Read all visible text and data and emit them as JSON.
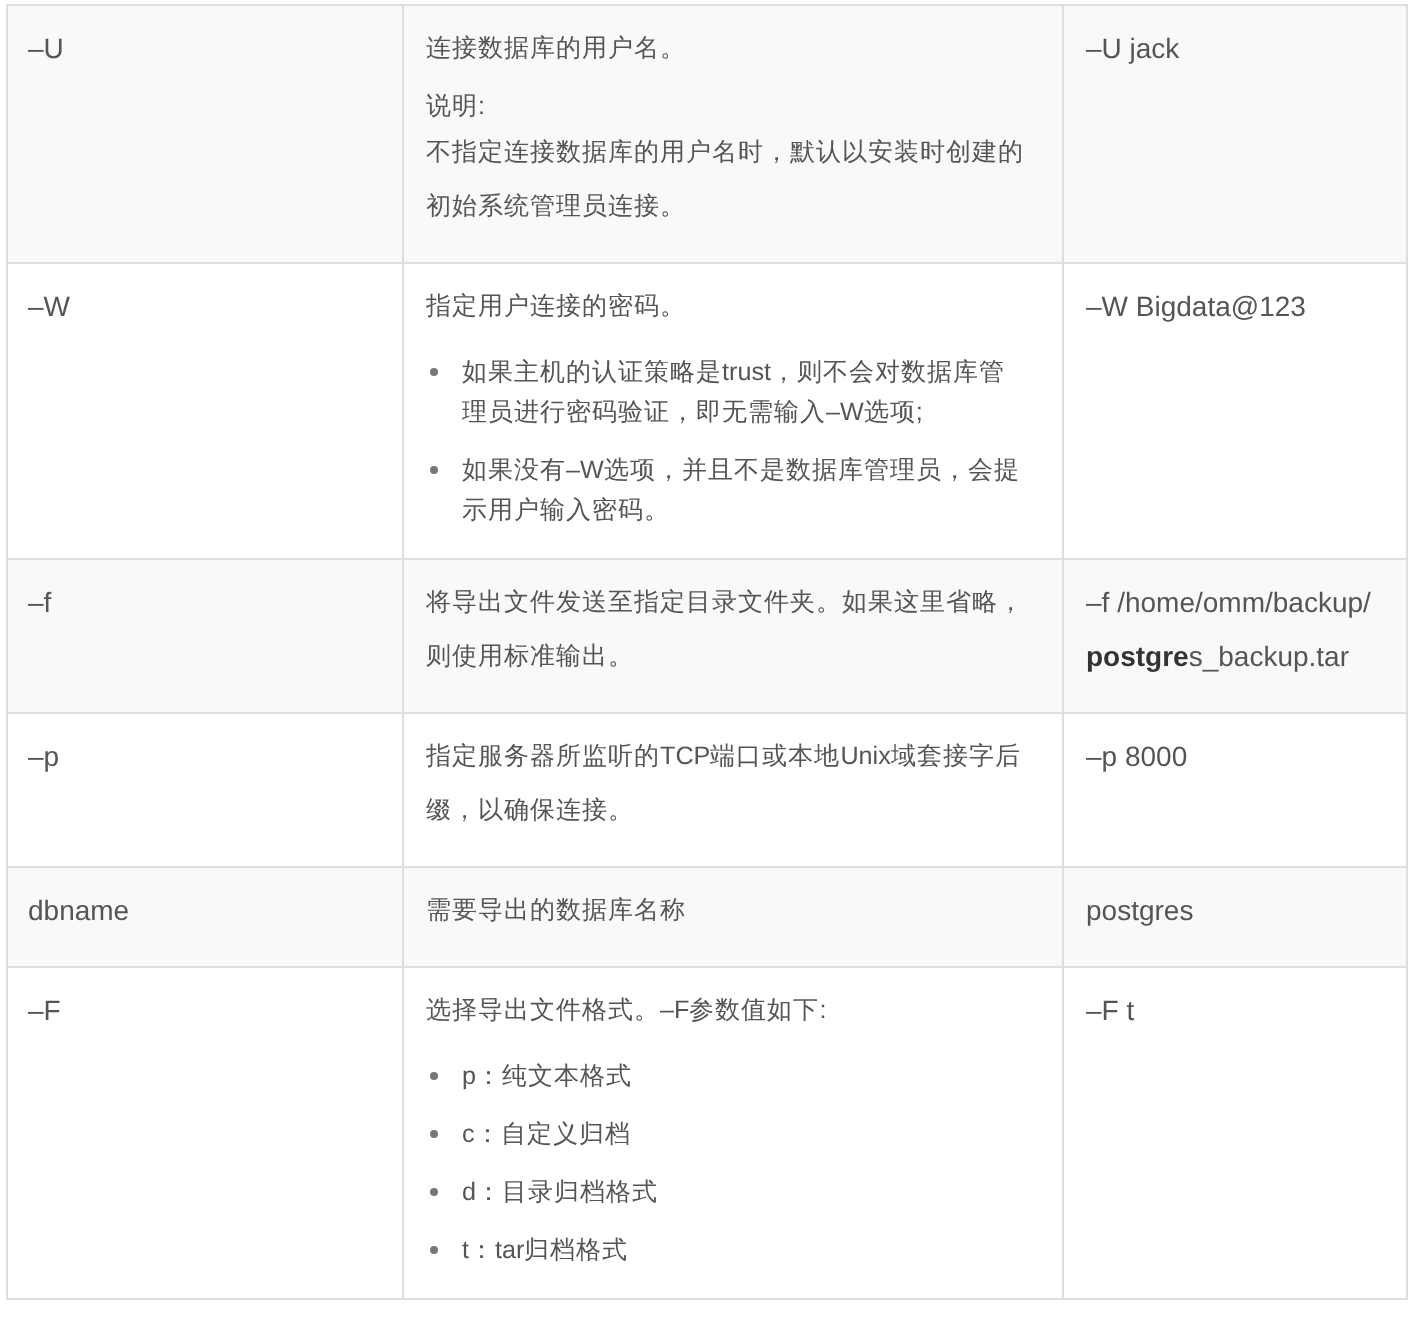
{
  "table": {
    "rows": [
      {
        "parameter": "–U",
        "description": [
          {
            "kind": "para",
            "text": "连接数据库的用户名。"
          },
          {
            "kind": "note",
            "label": "说明:",
            "text": "不指定连接数据库的用户名时，默认以安装时创建的初始系统管理员连接。"
          }
        ],
        "example": "–U jack"
      },
      {
        "parameter": "–W",
        "description": [
          {
            "kind": "para",
            "text": "指定用户连接的密码。"
          },
          {
            "kind": "bullets",
            "items": [
              "如果主机的认证策略是trust，则不会对数据库管理员进行密码验证，即无需输入–W选项;",
              "如果没有–W选项，并且不是数据库管理员，会提示用户输入密码。"
            ]
          }
        ],
        "example": "–W Bigdata@123"
      },
      {
        "parameter": "–f",
        "description": [
          {
            "kind": "para",
            "text": "将导出文件发送至指定目录文件夹。如果这里省略，则使用标准输出。"
          }
        ],
        "example": "–f /home/omm/backup/**postgre**s_backup.tar"
      },
      {
        "parameter": "–p",
        "description": [
          {
            "kind": "para",
            "text": "指定服务器所监听的TCP端口或本地Unix域套接字后缀，以确保连接。"
          }
        ],
        "example": "–p 8000"
      },
      {
        "parameter": "dbname",
        "description": [
          {
            "kind": "para",
            "text": "需要导出的数据库名称"
          }
        ],
        "example": "postgres"
      },
      {
        "parameter": "–F",
        "description": [
          {
            "kind": "para",
            "text": "选择导出文件格式。–F参数值如下:"
          },
          {
            "kind": "bullets",
            "items": [
              "p：纯文本格式",
              "c：自定义归档",
              "d：目录归档格式",
              "t：tar归档格式"
            ]
          }
        ],
        "example": "–F t"
      }
    ]
  }
}
